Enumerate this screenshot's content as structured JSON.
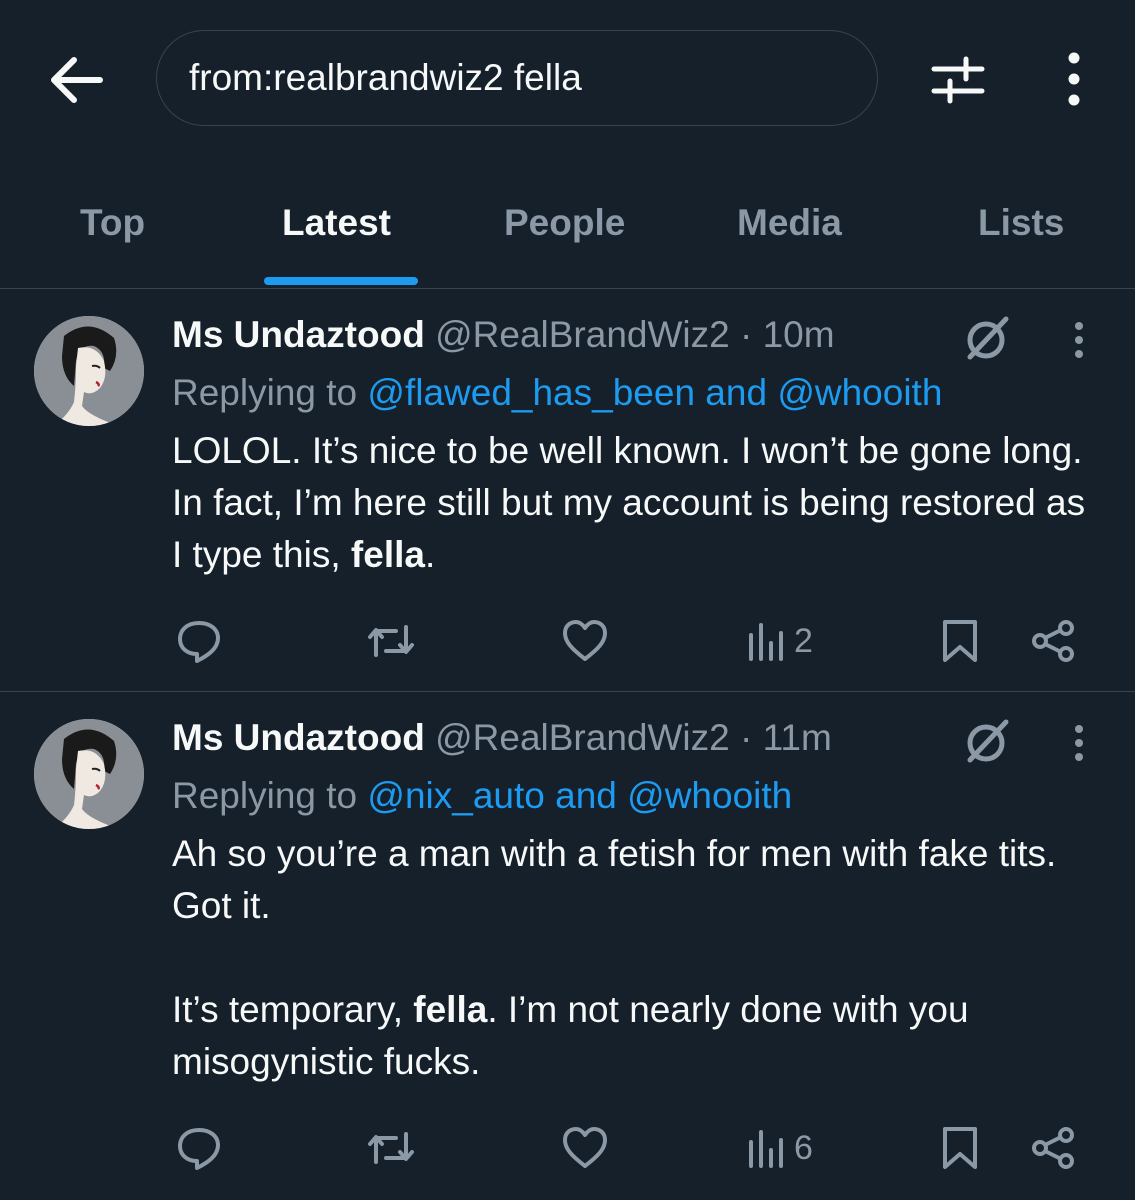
{
  "search": {
    "query": "from:realbrandwiz2 fella"
  },
  "tabs": [
    {
      "label": "Top"
    },
    {
      "label": "Latest"
    },
    {
      "label": "People"
    },
    {
      "label": "Media"
    },
    {
      "label": "Lists"
    }
  ],
  "active_tab": "Latest",
  "colors": {
    "background": "#15202b",
    "accent": "#1d9bf0",
    "muted": "#8b98a5",
    "divider": "#38444d"
  },
  "tweets": [
    {
      "name": "Ms Undaztood",
      "handle": "@RealBrandWiz2",
      "time": "· 10m",
      "replying_prefix": "Replying to",
      "replying_to": "@flawed_has_been and @whooith",
      "body_1a": "LOLOL. It’s nice to be well known. I won’t be gone long. In fact, I’m here still but my account is being restored as I type this, ",
      "body_1b": "fella",
      "body_1c": ".",
      "views": "2"
    },
    {
      "name": "Ms Undaztood",
      "handle": "@RealBrandWiz2",
      "time": "· 11m",
      "replying_prefix": "Replying to",
      "replying_to": "@nix_auto and @whooith",
      "body_1": "Ah so you’re a man with a fetish for men with fake tits. Got it.",
      "body_2a": "It’s temporary, ",
      "body_2b": "fella",
      "body_2c": ". I’m not nearly done with you misogynistic fucks.",
      "views": "6"
    }
  ]
}
